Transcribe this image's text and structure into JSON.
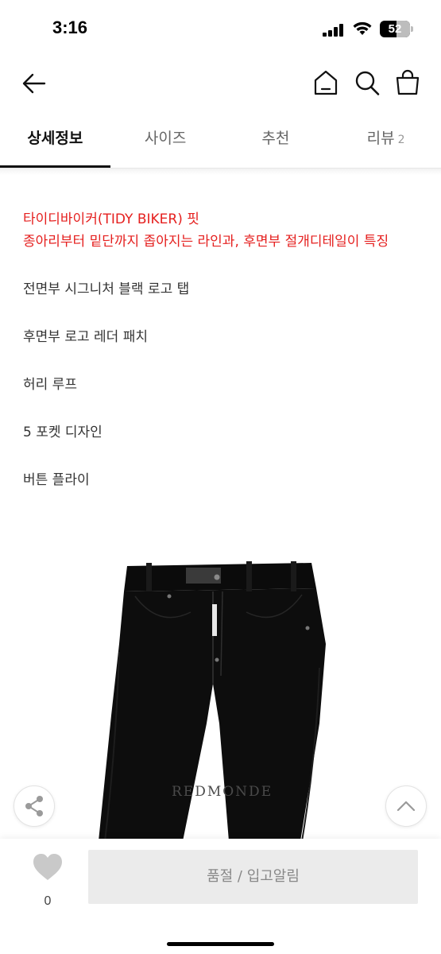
{
  "status_bar": {
    "time": "3:16",
    "battery": "52"
  },
  "header": {
    "back_icon": "arrow-left-icon",
    "home_icon": "home-icon",
    "search_icon": "search-icon",
    "bag_icon": "shopping-bag-icon"
  },
  "tabs": [
    {
      "label": "상세정보",
      "active": true
    },
    {
      "label": "사이즈",
      "active": false
    },
    {
      "label": "추천",
      "active": false
    },
    {
      "label": "리뷰",
      "count": "2",
      "active": false
    }
  ],
  "description": {
    "highlight_lines": [
      "타이디바이커(TIDY BIKER) 핏",
      "종아리부터 밑단까지 좁아지는 라인과, 후면부 절개디테일이 특징"
    ],
    "features": [
      "전면부 시그니처 블랙 로고 탭",
      "후면부 로고 레더 패치",
      "허리 루프",
      "5 포켓 디자인",
      "버튼 플라이"
    ]
  },
  "product_image": {
    "watermark": "REDMONDE",
    "subject": "black-jeans"
  },
  "floating": {
    "share_icon": "share-icon",
    "top_icon": "chevron-up-icon"
  },
  "bottom_bar": {
    "like_icon": "heart-icon",
    "like_count": "0",
    "action_label": "품절 / 입고알림"
  },
  "colors": {
    "highlight": "#e5201f",
    "active_tab": "#111111",
    "disabled_button": "#ebebeb"
  }
}
